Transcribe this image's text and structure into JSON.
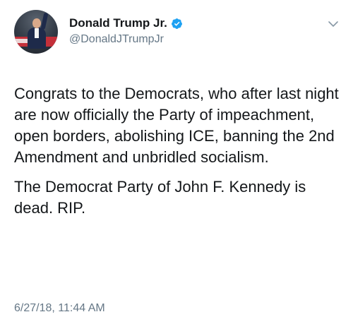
{
  "tweet": {
    "author": {
      "display_name": "Donald Trump Jr.",
      "handle": "@DonaldJTrumpJr",
      "verified": true,
      "verified_color": "#1da1f2",
      "avatar_icon": "profile-photo"
    },
    "menu_icon": "chevron-down-icon",
    "paragraph_1": "Congrats to the Democrats, who after last night are now officially the Party of impeachment, open borders, abolishing ICE, banning the 2nd Amendment and unbridled socialism.",
    "paragraph_2": "The Democrat Party of John F. Kennedy is dead. RIP.",
    "timestamp": "6/27/18, 11:44 AM"
  },
  "colors": {
    "text": "#14171a",
    "secondary_text": "#657786",
    "background": "#ffffff"
  }
}
